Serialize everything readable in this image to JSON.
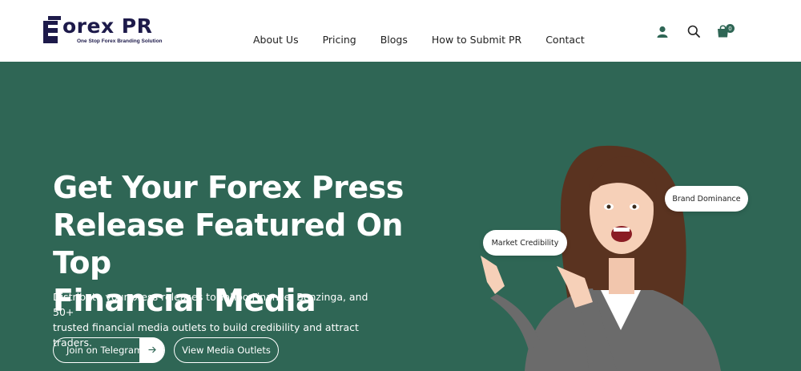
{
  "header": {
    "logo_text": "orex PR",
    "logo_tagline": "One Stop Forex Branding Solution",
    "nav": [
      {
        "label": "About Us"
      },
      {
        "label": "Pricing"
      },
      {
        "label": "Blogs"
      },
      {
        "label": "How to Submit PR"
      },
      {
        "label": "Contact"
      }
    ],
    "cart_count": "0"
  },
  "hero": {
    "headline_lines": [
      "Get Your Forex Press",
      "Release Featured On Top",
      "Financial Media"
    ],
    "subtext_lines": [
      "Distribute your press releases to Yahoo Finance, Benzinga, and 50+",
      "trusted financial media outlets to build credibility and attract traders."
    ],
    "btn_telegram": "Join on Telegram",
    "btn_media": "View Media Outlets",
    "pill_brand": "Brand Dominance",
    "pill_market": "Market Credibility"
  },
  "colors": {
    "brand_green": "#2f6655",
    "logo_navy": "#1d1a4a",
    "white": "#ffffff"
  }
}
